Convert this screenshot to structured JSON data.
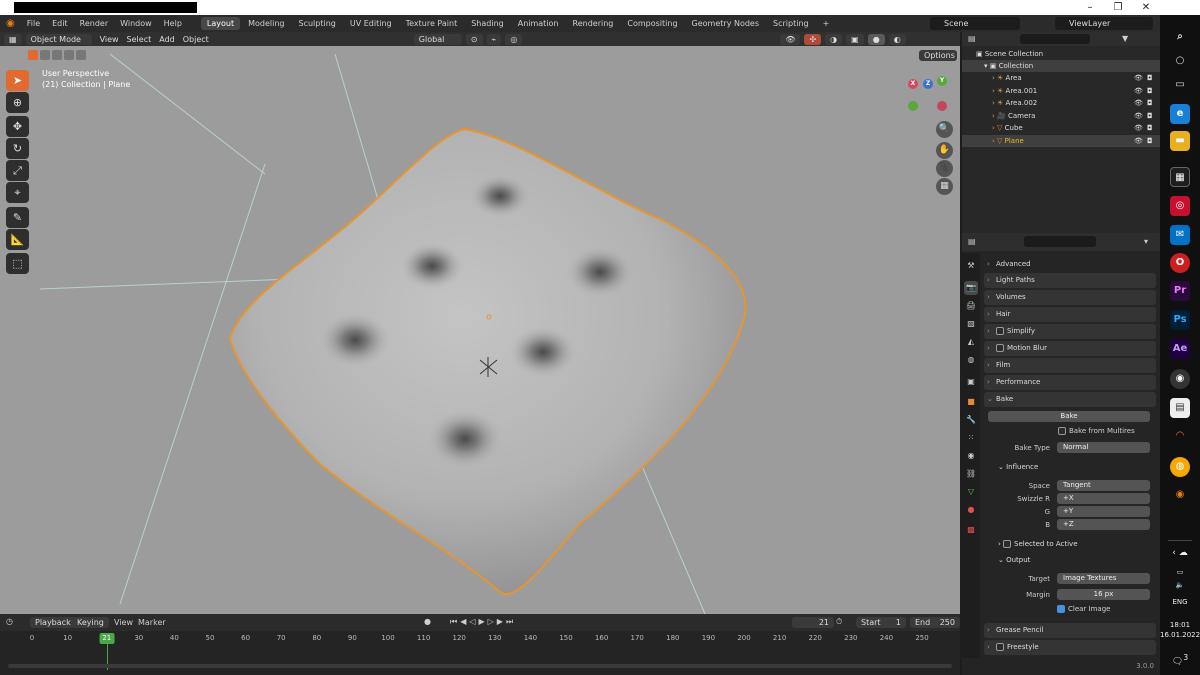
{
  "topbar": {
    "menus": [
      "File",
      "Edit",
      "Render",
      "Window",
      "Help"
    ],
    "workspaces": [
      "Layout",
      "Modeling",
      "Sculpting",
      "UV Editing",
      "Texture Paint",
      "Shading",
      "Animation",
      "Rendering",
      "Compositing",
      "Geometry Nodes",
      "Scripting"
    ],
    "add_tab": "+",
    "scene_label": "Scene",
    "viewlayer_label": "ViewLayer"
  },
  "viewport": {
    "mode": "Object Mode",
    "menus": [
      "View",
      "Select",
      "Add",
      "Object"
    ],
    "transform": "Global",
    "options": "Options",
    "perspective": "User Perspective",
    "collection_info": "(21) Collection | Plane",
    "gizmo": {
      "x": "X",
      "y": "Y",
      "z": "Z"
    }
  },
  "outliner": {
    "root": "Scene Collection",
    "collection": "Collection",
    "items": [
      {
        "label": "Area",
        "icon": "light-icon"
      },
      {
        "label": "Area.001",
        "icon": "light-icon"
      },
      {
        "label": "Area.002",
        "icon": "light-icon"
      },
      {
        "label": "Camera",
        "icon": "camera-icon"
      },
      {
        "label": "Cube",
        "icon": "mesh-icon"
      },
      {
        "label": "Plane",
        "icon": "mesh-icon"
      }
    ]
  },
  "properties": {
    "panels_top": [
      "Advanced",
      "Light Paths",
      "Volumes",
      "Hair",
      "Simplify",
      "Motion Blur",
      "Film",
      "Performance",
      "Bake"
    ],
    "bake_button": "Bake",
    "bake_from_multires": "Bake from Multires",
    "bake_type_label": "Bake Type",
    "bake_type_value": "Normal",
    "influence": "Influence",
    "space_label": "Space",
    "space_value": "Tangent",
    "swizzle_label": "Swizzle R",
    "swizzle_g_label": "G",
    "swizzle_b_label": "B",
    "swizzle_r": "+X",
    "swizzle_g": "+Y",
    "swizzle_b": "+Z",
    "selected_to_active": "Selected to Active",
    "output": "Output",
    "target_label": "Target",
    "target_value": "Image Textures",
    "margin_label": "Margin",
    "margin_value": "16 px",
    "clear_image": "Clear Image",
    "panels_bottom": [
      "Grease Pencil",
      "Freestyle"
    ]
  },
  "timeline": {
    "playback": "Playback",
    "keying": "Keying",
    "view": "View",
    "marker": "Marker",
    "current_frame": "21",
    "start_label": "Start",
    "start": "1",
    "end_label": "End",
    "end": "250",
    "ticks": [
      "0",
      "10",
      "20",
      "30",
      "40",
      "50",
      "60",
      "70",
      "80",
      "90",
      "100",
      "110",
      "120",
      "130",
      "140",
      "150",
      "160",
      "170",
      "180",
      "190",
      "200",
      "210",
      "220",
      "230",
      "240",
      "250"
    ]
  },
  "status": {
    "version": "3.0.0"
  },
  "taskbar": {
    "time": "18:01",
    "date": "16.01.2022",
    "lang": "ENG",
    "notif": "3"
  },
  "colors": {
    "accent": "#e06a2f",
    "selection": "#f3b533",
    "frame": "#4aa84a",
    "viewport_bg": "#9c9c9c"
  }
}
